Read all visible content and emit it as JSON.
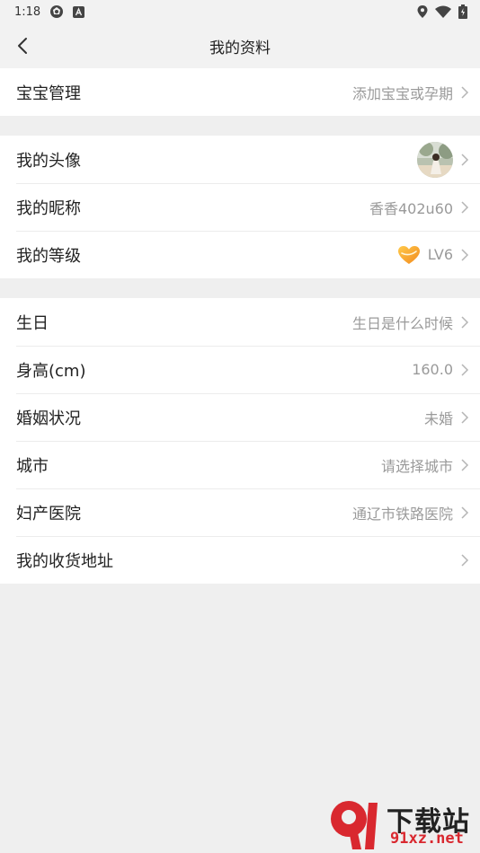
{
  "status": {
    "time": "1:18"
  },
  "header": {
    "title": "我的资料"
  },
  "sections": [
    [
      {
        "label": "宝宝管理",
        "value": "添加宝宝或孕期"
      }
    ],
    [
      {
        "label": "我的头像",
        "value": ""
      },
      {
        "label": "我的昵称",
        "value": "香香402u60"
      },
      {
        "label": "我的等级",
        "value": "LV6"
      }
    ],
    [
      {
        "label": "生日",
        "value": "生日是什么时候"
      },
      {
        "label": "身高(cm)",
        "value": "160.0"
      },
      {
        "label": "婚姻状况",
        "value": "未婚"
      },
      {
        "label": "城市",
        "value": "请选择城市"
      },
      {
        "label": "妇产医院",
        "value": "通辽市铁路医院"
      },
      {
        "label": "我的收货地址",
        "value": ""
      }
    ]
  ],
  "watermark": {
    "brand": "下载站",
    "site": "91xz.net"
  },
  "colors": {
    "accent": "#f5a623",
    "watermark_red": "#d9282f"
  }
}
